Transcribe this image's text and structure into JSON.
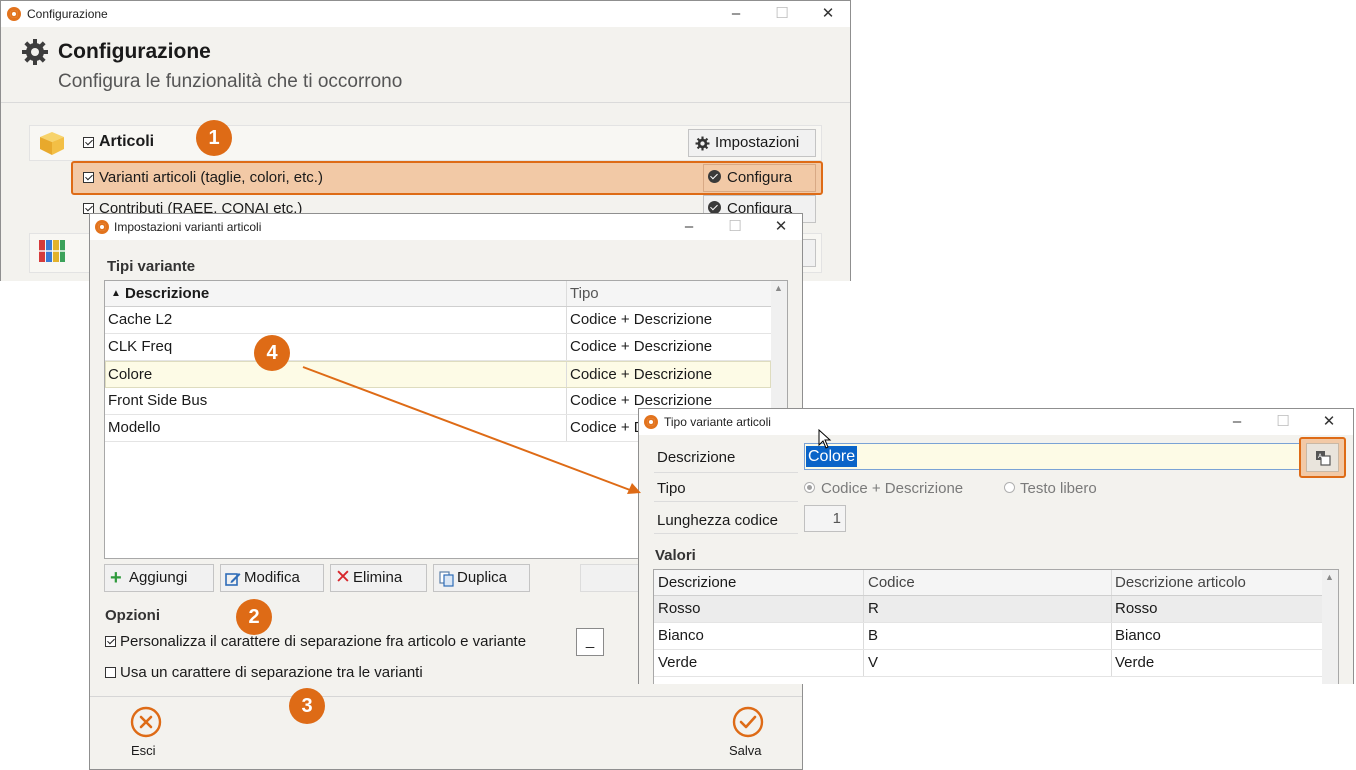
{
  "config_window": {
    "title": "Configurazione",
    "heading": "Configurazione",
    "subtitle": "Configura le funzionalità che ti occorrono",
    "minimize": "–",
    "maximize": "☐",
    "close": "✕",
    "articoli_label": "Articoli",
    "impostazioni_label": "Impostazioni",
    "varianti_label": "Varianti articoli (taglie, colori, etc.)",
    "configura_label": "Configura",
    "contributi_label": "Contributi (RAEE, CONAI etc.)",
    "configura_label_2": "Configura"
  },
  "badges": {
    "b1": "1",
    "b2": "2",
    "b3": "3",
    "b4": "4"
  },
  "impostazioni_window": {
    "title": "Impostazioni varianti articoli",
    "minimize": "–",
    "maximize": "☐",
    "close": "✕",
    "section_tipi": "Tipi variante",
    "columns": {
      "descrizione": "Descrizione",
      "tipo": "Tipo"
    },
    "rows": [
      {
        "descrizione": "Cache L2",
        "tipo": "Codice + Descrizione"
      },
      {
        "descrizione": "CLK Freq",
        "tipo": "Codice + Descrizione"
      },
      {
        "descrizione": "Colore",
        "tipo": "Codice + Descrizione"
      },
      {
        "descrizione": "Front Side Bus",
        "tipo": "Codice + Descrizione"
      },
      {
        "descrizione": "Modello",
        "tipo": "Codice + Descrizione"
      }
    ],
    "buttons": {
      "aggiungi": "Aggiungi",
      "modifica": "Modifica",
      "elimina": "Elimina",
      "duplica": "Duplica"
    },
    "section_opzioni": "Opzioni",
    "opt_personalizza": "Personalizza il carattere di separazione fra articolo e variante",
    "separator_value": "_",
    "opt_usa": "Usa un carattere di separazione tra le varianti",
    "esci": "Esci",
    "salva": "Salva"
  },
  "tipo_window": {
    "title": "Tipo variante articoli",
    "minimize": "–",
    "maximize": "☐",
    "close": "✕",
    "descrizione_label": "Descrizione",
    "descrizione_value": "Colore",
    "tipo_label": "Tipo",
    "radio_codice": "Codice + Descrizione",
    "radio_testo": "Testo libero",
    "lunghezza_label": "Lunghezza codice",
    "lunghezza_value": "1",
    "section_valori": "Valori",
    "columns": {
      "descrizione": "Descrizione",
      "codice": "Codice",
      "descrizione_articolo": "Descrizione articolo"
    },
    "rows": [
      {
        "descrizione": "Rosso",
        "codice": "R",
        "descrizione_articolo": "Rosso"
      },
      {
        "descrizione": "Bianco",
        "codice": "B",
        "descrizione_articolo": "Bianco"
      },
      {
        "descrizione": "Verde",
        "codice": "V",
        "descrizione_articolo": "Verde"
      }
    ]
  },
  "colors": {
    "accent": "#de6b16",
    "highlight": "#f2c9a6",
    "selection": "#0a64c8"
  }
}
